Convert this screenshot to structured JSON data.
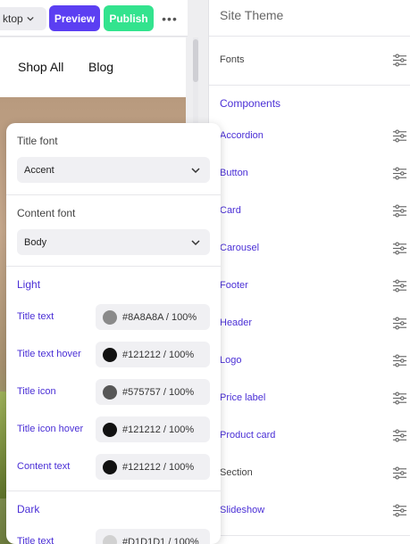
{
  "toolbar": {
    "device_label": "ktop",
    "preview_label": "Preview",
    "publish_label": "Publish",
    "more_label": "•••"
  },
  "site_nav": {
    "links": [
      "Shop All",
      "Blog"
    ]
  },
  "theme_panel": {
    "title": "Site Theme",
    "fonts_label": "Fonts",
    "components_title": "Components",
    "components": [
      {
        "label": "Accordion",
        "style": "link"
      },
      {
        "label": "Button",
        "style": "link"
      },
      {
        "label": "Card",
        "style": "link"
      },
      {
        "label": "Carousel",
        "style": "link"
      },
      {
        "label": "Footer",
        "style": "link"
      },
      {
        "label": "Header",
        "style": "link"
      },
      {
        "label": "Logo",
        "style": "link"
      },
      {
        "label": "Price label",
        "style": "link"
      },
      {
        "label": "Product card",
        "style": "link"
      },
      {
        "label": "Section",
        "style": "plain"
      },
      {
        "label": "Slideshow",
        "style": "link"
      }
    ]
  },
  "popover": {
    "title_font_label": "Title font",
    "title_font_value": "Accent",
    "content_font_label": "Content font",
    "content_font_value": "Body",
    "light": {
      "heading": "Light",
      "colors": [
        {
          "label": "Title text",
          "value": "#8A8A8A / 100%",
          "color": "#8A8A8A"
        },
        {
          "label": "Title text hover",
          "value": "#121212 / 100%",
          "color": "#121212"
        },
        {
          "label": "Title icon",
          "value": "#575757 / 100%",
          "color": "#575757"
        },
        {
          "label": "Title icon hover",
          "value": "#121212 / 100%",
          "color": "#121212"
        },
        {
          "label": "Content text",
          "value": "#121212 / 100%",
          "color": "#121212"
        }
      ]
    },
    "dark": {
      "heading": "Dark",
      "colors": [
        {
          "label": "Title text",
          "value": "#D1D1D1 / 100%",
          "color": "#D1D1D1"
        }
      ]
    }
  },
  "colors": {
    "accent_purple": "#5b3ff2",
    "publish_green": "#33e38e",
    "link_color": "#4a2fd6"
  }
}
